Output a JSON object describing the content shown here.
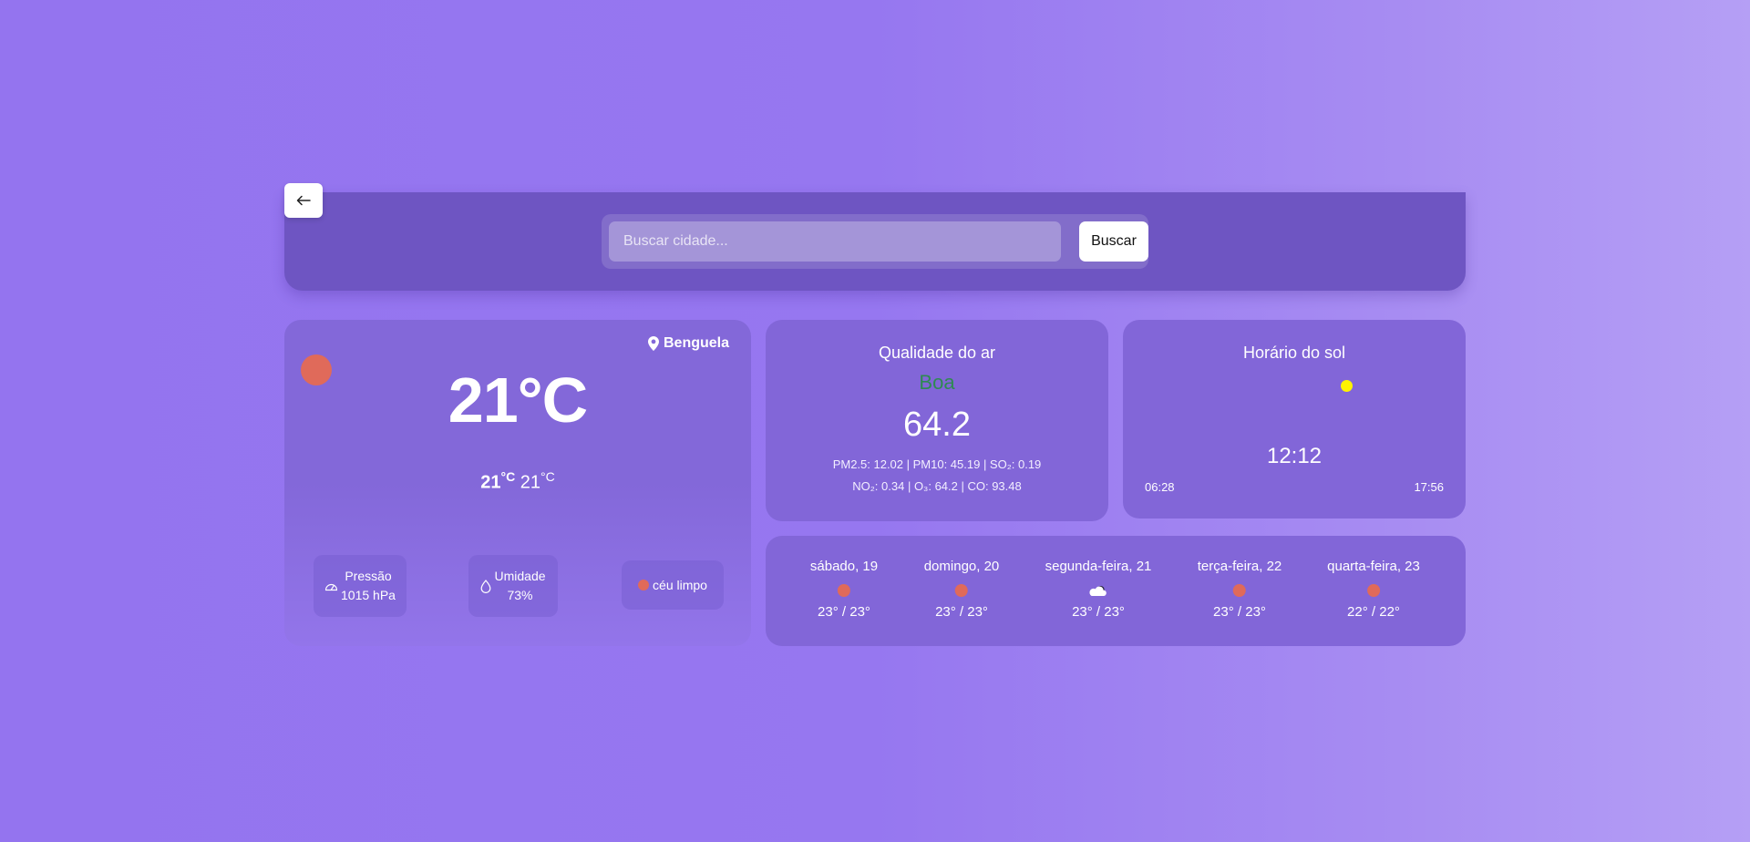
{
  "nav": {
    "back_icon": "arrow-left-icon"
  },
  "search": {
    "placeholder": "Buscar cidade...",
    "button_label": "Buscar"
  },
  "weather": {
    "city": "Benguela",
    "temperature": "21°C",
    "temp_max": "21",
    "temp_min": "21",
    "temp_unit": "°C",
    "icon": "sun-icon",
    "icon_color": "#e06a5a",
    "pressure_label": "Pressão",
    "pressure_value": "1015 hPa",
    "humidity_label": "Umidade",
    "humidity_value": "73%",
    "description": "céu limpo"
  },
  "air_quality": {
    "title": "Qualidade do ar",
    "status": "Boa",
    "status_color": "#2f8a52",
    "value": "64.2",
    "line1": "PM2.5: 12.02 | PM10: 45.19 | SO₂: 0.19",
    "line2": "NO₂: 0.34 | O₃: 64.2 | CO: 93.48"
  },
  "sun": {
    "title": "Horário do sol",
    "current_time": "12:12",
    "sunrise": "06:28",
    "sunset": "17:56",
    "marker_color": "#fff200"
  },
  "forecast": [
    {
      "day": "sábado, 19",
      "temps": "23° / 23°",
      "icon": "sun-icon"
    },
    {
      "day": "domingo, 20",
      "temps": "23° / 23°",
      "icon": "sun-icon"
    },
    {
      "day": "segunda-feira, 21",
      "temps": "23° / 23°",
      "icon": "cloud-icon"
    },
    {
      "day": "terça-feira, 22",
      "temps": "23° / 23°",
      "icon": "sun-icon"
    },
    {
      "day": "quarta-feira, 23",
      "temps": "22° / 22°",
      "icon": "sun-icon"
    }
  ]
}
